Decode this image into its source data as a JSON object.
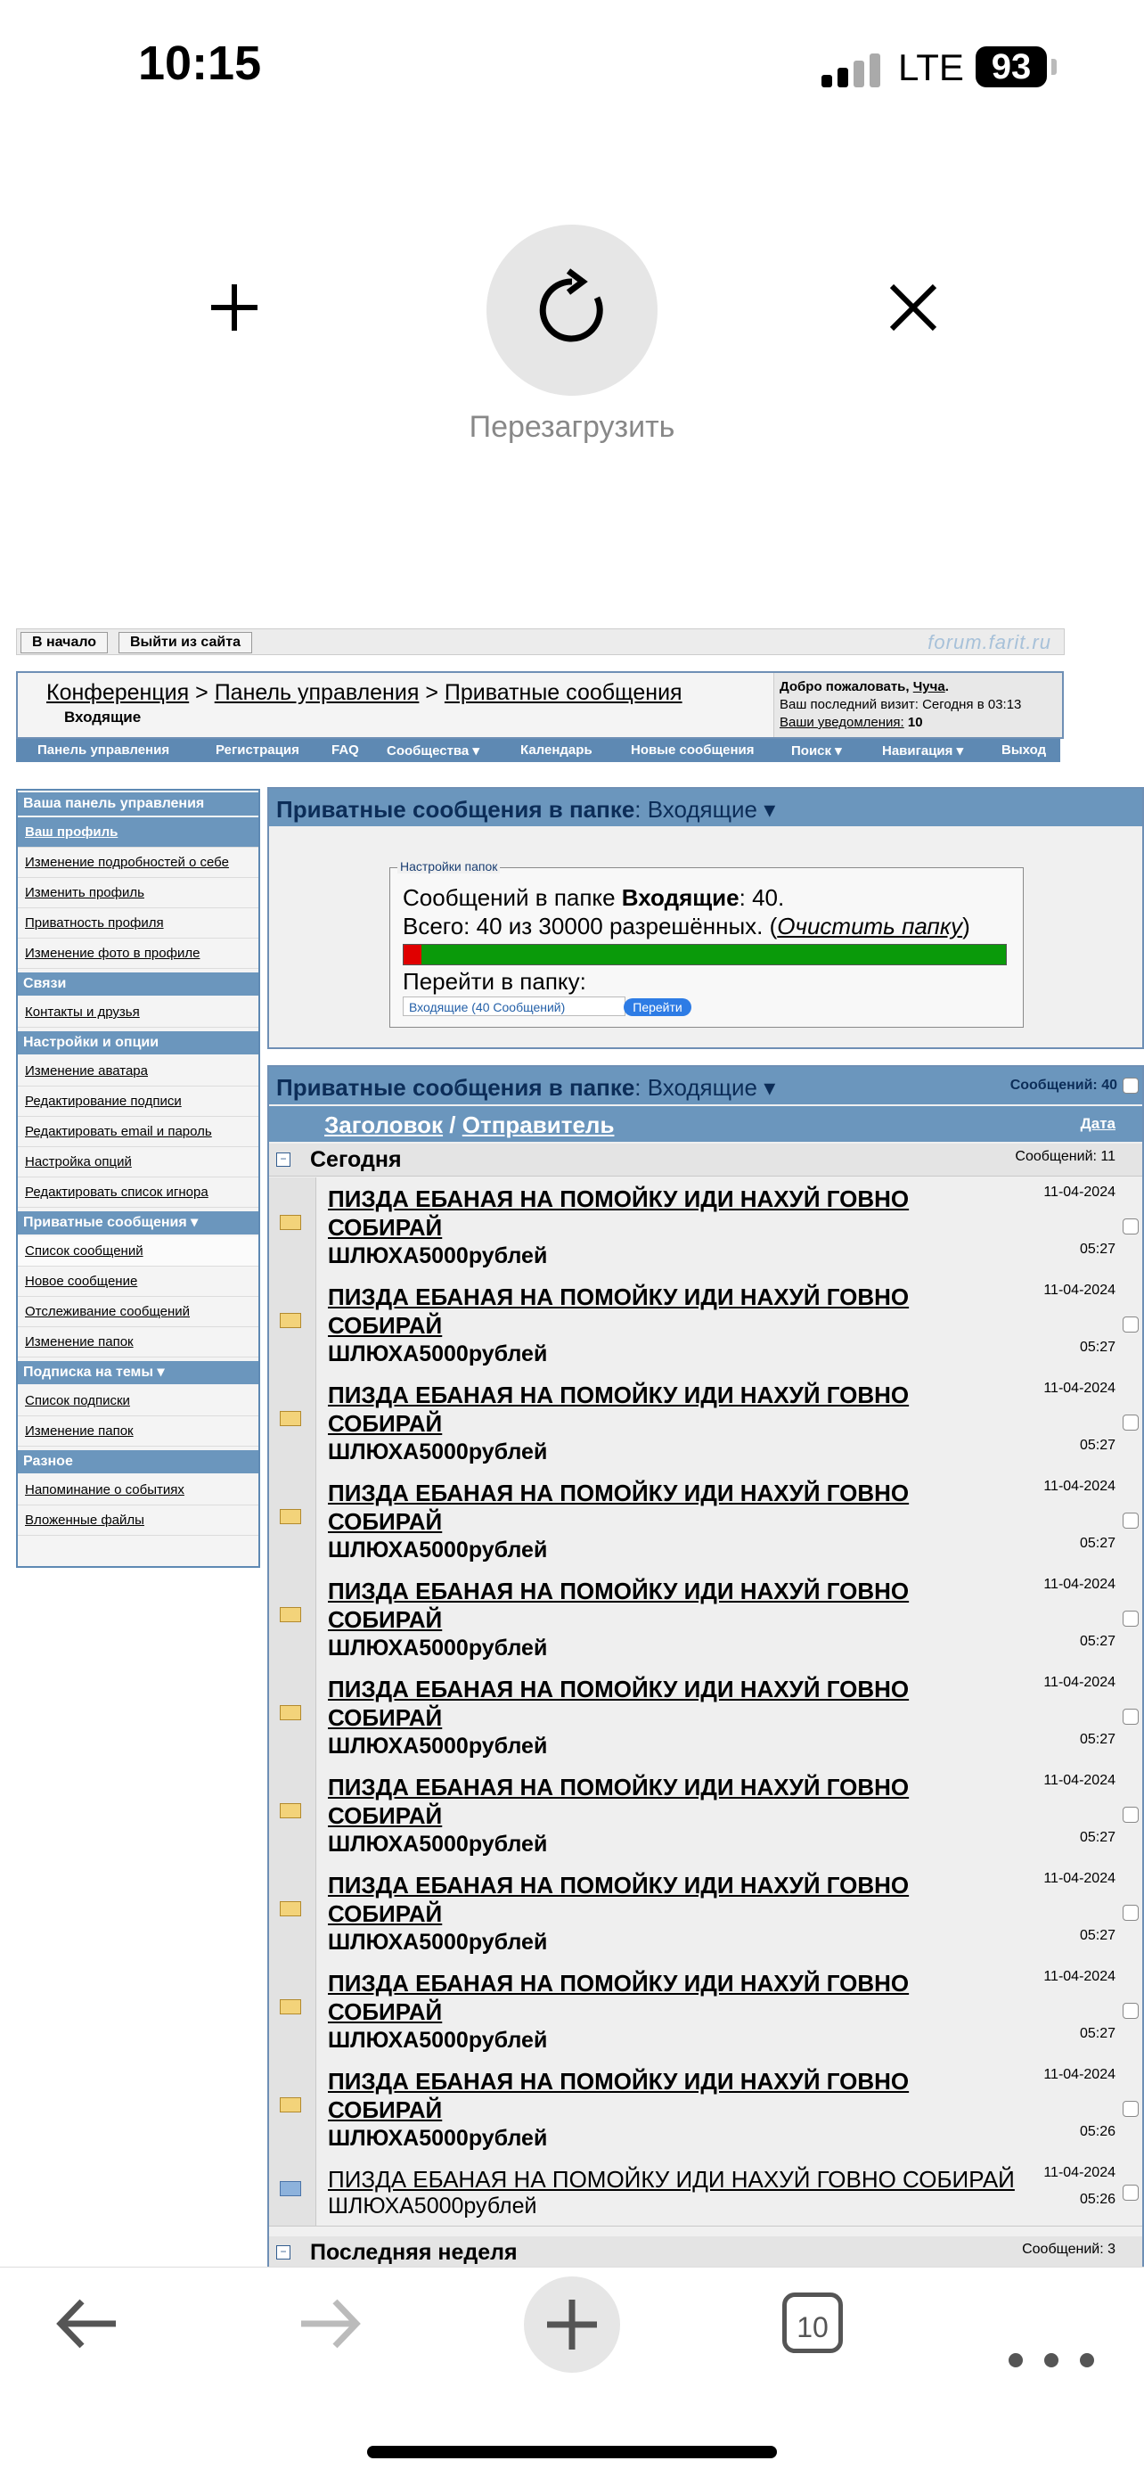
{
  "status": {
    "time": "10:15",
    "network": "LTE",
    "battery": "93"
  },
  "pulldown": {
    "reload_label": "Перезагрузить"
  },
  "site": {
    "topnav": {
      "home": "В начало",
      "logout": "Выйти из сайта",
      "logo": "forum.farit.ru"
    },
    "breadcrumb": {
      "part1": "Конференция",
      "sep": ">",
      "part2": "Панель управления",
      "part3": "Приватные сообщения",
      "current": "Входящие"
    },
    "welcome": {
      "line1_prefix": "Добро пожаловать,",
      "user": "Чуча",
      "line2_prefix": "Ваш последний визит:",
      "last_visit": "Сегодня в 03:13",
      "notif_label": "Ваши уведомления:",
      "notif_count": "10"
    },
    "navbar": [
      "Панель управления",
      "Регистрация",
      "FAQ",
      "Сообщества ▾",
      "Календарь",
      "Новые сообщения",
      "Поиск ▾",
      "Навигация ▾",
      "Выход"
    ],
    "sidebar": {
      "sections": [
        {
          "title": "Ваша панель управления",
          "items": [
            "Ваш профиль",
            "Изменение подробностей о себе",
            "Изменить профиль",
            "Приватность профиля",
            "Изменение фото в профиле"
          ]
        },
        {
          "title": "Связи",
          "items": [
            "Контакты и друзья"
          ]
        },
        {
          "title": "Настройки и опции",
          "items": [
            "Изменение аватара",
            "Редактирование подписи",
            "Редактировать email и пароль",
            "Настройка опций",
            "Редактировать список игнора"
          ]
        },
        {
          "title": "Приватные сообщения ▾",
          "items": [
            "Список сообщений",
            "Новое сообщение",
            "Отслеживание сообщений",
            "Изменение папок"
          ]
        },
        {
          "title": "Подписка на темы ▾",
          "items": [
            "Список подписки",
            "Изменение папок"
          ]
        },
        {
          "title": "Разное",
          "items": [
            "Напоминание о событиях",
            "Вложенные файлы"
          ]
        }
      ]
    },
    "folder_panel": {
      "title": "Приватные сообщения в папке",
      "folder": ": Входящие ▾",
      "legend": "Настройки папок",
      "count_prefix": "Сообщений в папке ",
      "count_folder": "Входящие",
      "count_value": ": 40.",
      "total_prefix": "Всего: 40 из 30000 разрешённых. (",
      "clear_link": "Очистить папку",
      "total_suffix": ")",
      "usage_fraction": 0.0013,
      "goto_label": "Перейти в папку:",
      "goto_select": "Входящие (40 Сообщений)",
      "goto_button": "Перейти"
    },
    "list_panel": {
      "title": "Приватные сообщения в папке",
      "folder": ": Входящие ▾",
      "total": "Сообщений: 40",
      "col_subject": "Заголовок",
      "col_sep": "/",
      "col_sender": "Отправитель",
      "col_date": "Дата",
      "group_today": {
        "name": "Сегодня",
        "count": "Сообщений: 11"
      },
      "group_week": {
        "name": "Последняя неделя",
        "count": "Сообщений: 3"
      },
      "messages": [
        {
          "subject": "ПИЗДА ЕБАНАЯ НА ПОМОЙКУ ИДИ НАХУЙ ГОВНО СОБИРАЙ",
          "sender": "ШЛЮХА5000рублей",
          "date": "11-04-2024",
          "time": "05:27"
        },
        {
          "subject": "ПИЗДА ЕБАНАЯ НА ПОМОЙКУ ИДИ НАХУЙ ГОВНО СОБИРАЙ",
          "sender": "ШЛЮХА5000рублей",
          "date": "11-04-2024",
          "time": "05:27"
        },
        {
          "subject": "ПИЗДА ЕБАНАЯ НА ПОМОЙКУ ИДИ НАХУЙ ГОВНО СОБИРАЙ",
          "sender": "ШЛЮХА5000рублей",
          "date": "11-04-2024",
          "time": "05:27"
        },
        {
          "subject": "ПИЗДА ЕБАНАЯ НА ПОМОЙКУ ИДИ НАХУЙ ГОВНО СОБИРАЙ",
          "sender": "ШЛЮХА5000рублей",
          "date": "11-04-2024",
          "time": "05:27"
        },
        {
          "subject": "ПИЗДА ЕБАНАЯ НА ПОМОЙКУ ИДИ НАХУЙ ГОВНО СОБИРАЙ",
          "sender": "ШЛЮХА5000рублей",
          "date": "11-04-2024",
          "time": "05:27"
        },
        {
          "subject": "ПИЗДА ЕБАНАЯ НА ПОМОЙКУ ИДИ НАХУЙ ГОВНО СОБИРАЙ",
          "sender": "ШЛЮХА5000рублей",
          "date": "11-04-2024",
          "time": "05:27"
        },
        {
          "subject": "ПИЗДА ЕБАНАЯ НА ПОМОЙКУ ИДИ НАХУЙ ГОВНО СОБИРАЙ",
          "sender": "ШЛЮХА5000рублей",
          "date": "11-04-2024",
          "time": "05:27"
        },
        {
          "subject": "ПИЗДА ЕБАНАЯ НА ПОМОЙКУ ИДИ НАХУЙ ГОВНО СОБИРАЙ",
          "sender": "ШЛЮХА5000рублей",
          "date": "11-04-2024",
          "time": "05:27"
        },
        {
          "subject": "ПИЗДА ЕБАНАЯ НА ПОМОЙКУ ИДИ НАХУЙ ГОВНО СОБИРАЙ",
          "sender": "ШЛЮХА5000рублей",
          "date": "11-04-2024",
          "time": "05:27"
        },
        {
          "subject": "ПИЗДА ЕБАНАЯ НА ПОМОЙКУ ИДИ НАХУЙ ГОВНО СОБИРАЙ",
          "sender": "ШЛЮХА5000рублей",
          "date": "11-04-2024",
          "time": "05:26"
        },
        {
          "subject": "ПИЗДА ЕБАНАЯ НА ПОМОЙКУ ИДИ НАХУЙ ГОВНО СОБИРАЙ",
          "sender": "ШЛЮХА5000рублей",
          "date": "11-04-2024",
          "time": "05:26",
          "read": true
        }
      ]
    }
  },
  "toolbar": {
    "tab_count": "10"
  }
}
